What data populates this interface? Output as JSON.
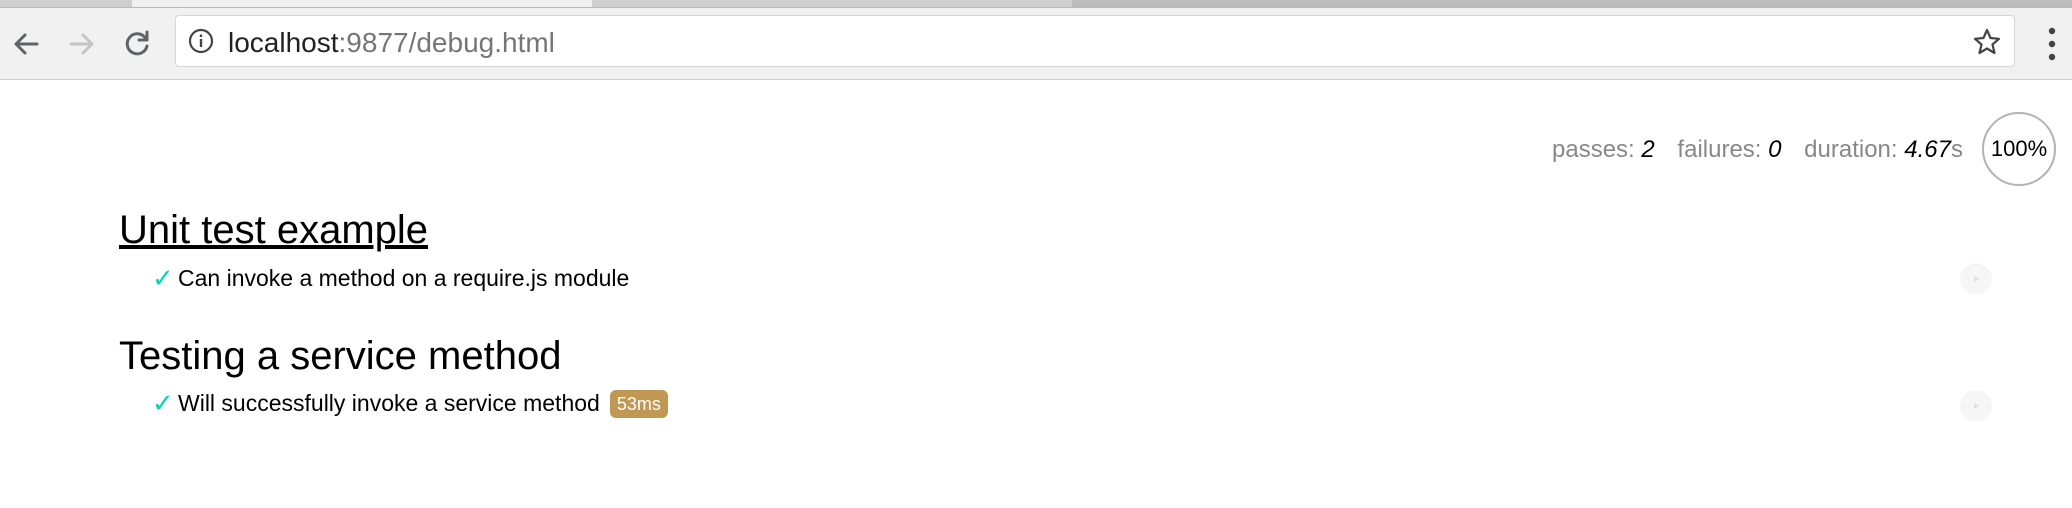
{
  "browser": {
    "url_host": "localhost",
    "url_rest": ":9877/debug.html",
    "icons": {
      "back": "arrow-left-icon",
      "forward": "arrow-right-icon",
      "reload": "reload-icon",
      "site_info": "info-circle-icon",
      "bookmark": "star-icon",
      "menu": "vertical-ellipsis-icon"
    }
  },
  "report": {
    "stats": {
      "passes_label": "passes:",
      "passes_value": "2",
      "failures_label": "failures:",
      "failures_value": "0",
      "duration_label": "duration:",
      "duration_value": "4.67",
      "duration_unit": "s"
    },
    "progress": "100%",
    "suites": [
      {
        "title": "Unit test example",
        "tests": [
          {
            "mark": "✓",
            "title": "Can invoke a method on a require.js module"
          }
        ]
      },
      {
        "title": "Testing a service method",
        "tests": [
          {
            "mark": "✓",
            "title": "Will successfully invoke a service method",
            "duration": "53ms"
          }
        ]
      }
    ]
  },
  "colors": {
    "pass_check": "#00d6b2",
    "duration_badge": "#c09853"
  }
}
